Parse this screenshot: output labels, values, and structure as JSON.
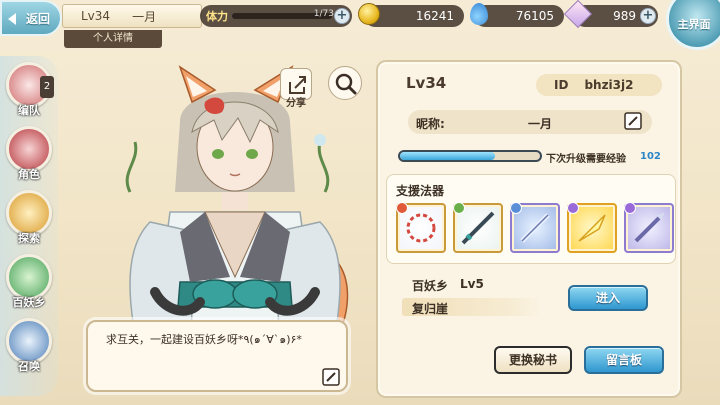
{
  "topbar": {
    "back_label": "返回",
    "player_level": "Lv34",
    "player_name": "一月",
    "detail_tab": "个人详情",
    "stamina_label": "体力",
    "stamina_value": "1/73",
    "gold": "16241",
    "crystal": "76105",
    "gem": "989",
    "main_menu_label": "主界面"
  },
  "nav": {
    "team": "编队",
    "team_badge": "2",
    "role": "角色",
    "explore": "探索",
    "village": "百妖乡",
    "summon": "召唤"
  },
  "actions": {
    "share_label": "分享"
  },
  "speech": {
    "text": "求互关，一起建设百妖乡呀*٩(๑´∀`๑)۶*"
  },
  "profile": {
    "level": "Lv34",
    "id_label": "ID",
    "id_value": "bhzi3j2",
    "nick_label": "昵称:",
    "nick_value": "一月",
    "exp_label": "下次升级需要经验",
    "exp_value": "102",
    "exp_progress": 0.68,
    "artifact_title": "支援法器",
    "village_name": "百妖乡",
    "village_level": "Lv5",
    "village_place": "复归崖",
    "enter_label": "进入",
    "swap_label": "更换秘书",
    "message_label": "留言板"
  },
  "colors": {
    "accent_blue": "#2f97cf",
    "panel_bg": "#fbf4e4",
    "exp_value": "#2b86c9"
  }
}
